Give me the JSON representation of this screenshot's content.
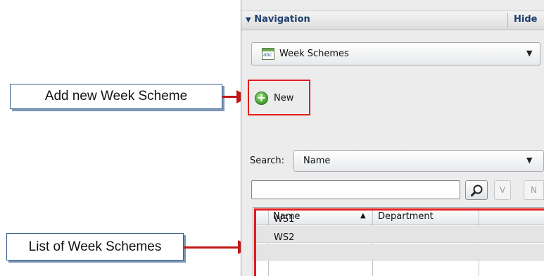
{
  "callouts": {
    "add_new": "Add new Week Scheme",
    "list": "List of Week Schemes"
  },
  "navigation": {
    "title": "Navigation",
    "hide": "Hide",
    "module_select": {
      "value": "Week Schemes",
      "icon": "calendar-abc-icon",
      "icon_text": "abc"
    },
    "new_button": {
      "label": "New",
      "icon": "add-circle-icon"
    },
    "search": {
      "label": "Search:",
      "field_value": "Name",
      "input_value": "",
      "search_icon": "magnifier-icon",
      "v_label": "V",
      "n_label": "N"
    },
    "grid": {
      "columns": [
        "Name",
        "Department"
      ],
      "sort_indicator": "▲",
      "rows": [
        {
          "name": "WS1",
          "department": ""
        },
        {
          "name": "WS2",
          "department": ""
        }
      ]
    }
  },
  "colors": {
    "highlight": "#e31c1c",
    "title_text": "#1f3f6e",
    "arrow": "#c01818"
  }
}
